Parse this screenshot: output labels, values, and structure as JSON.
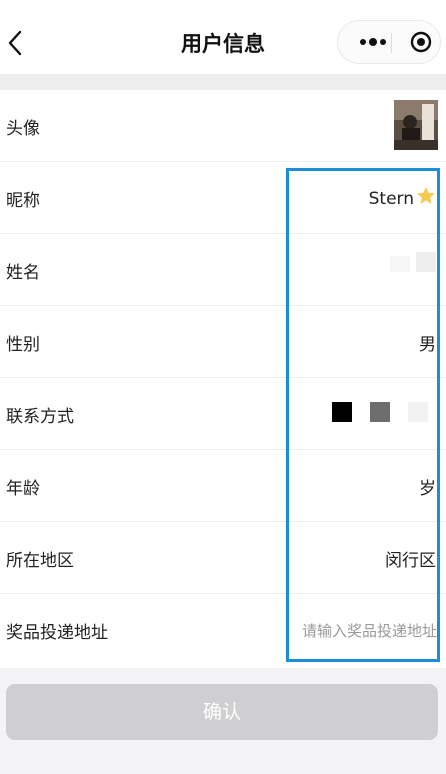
{
  "header": {
    "title": "用户信息"
  },
  "rows": [
    {
      "label": "头像",
      "value": ""
    },
    {
      "label": "昵称",
      "value": "Stern"
    },
    {
      "label": "姓名",
      "value": ""
    },
    {
      "label": "性别",
      "value": "男"
    },
    {
      "label": "联系方式",
      "value": ""
    },
    {
      "label": "年龄",
      "value": "岁"
    },
    {
      "label": "所在地区",
      "value": "闵行区"
    },
    {
      "label": "奖品投递地址",
      "placeholder": "请输入奖品投递地址"
    }
  ],
  "confirm_button": {
    "label": "确认"
  },
  "colors": {
    "highlight": "#1a8ed6",
    "button_disabled": "#cfcfd2"
  },
  "icons": [
    "back-icon",
    "more-icon",
    "target-icon",
    "star-emoji-icon"
  ]
}
